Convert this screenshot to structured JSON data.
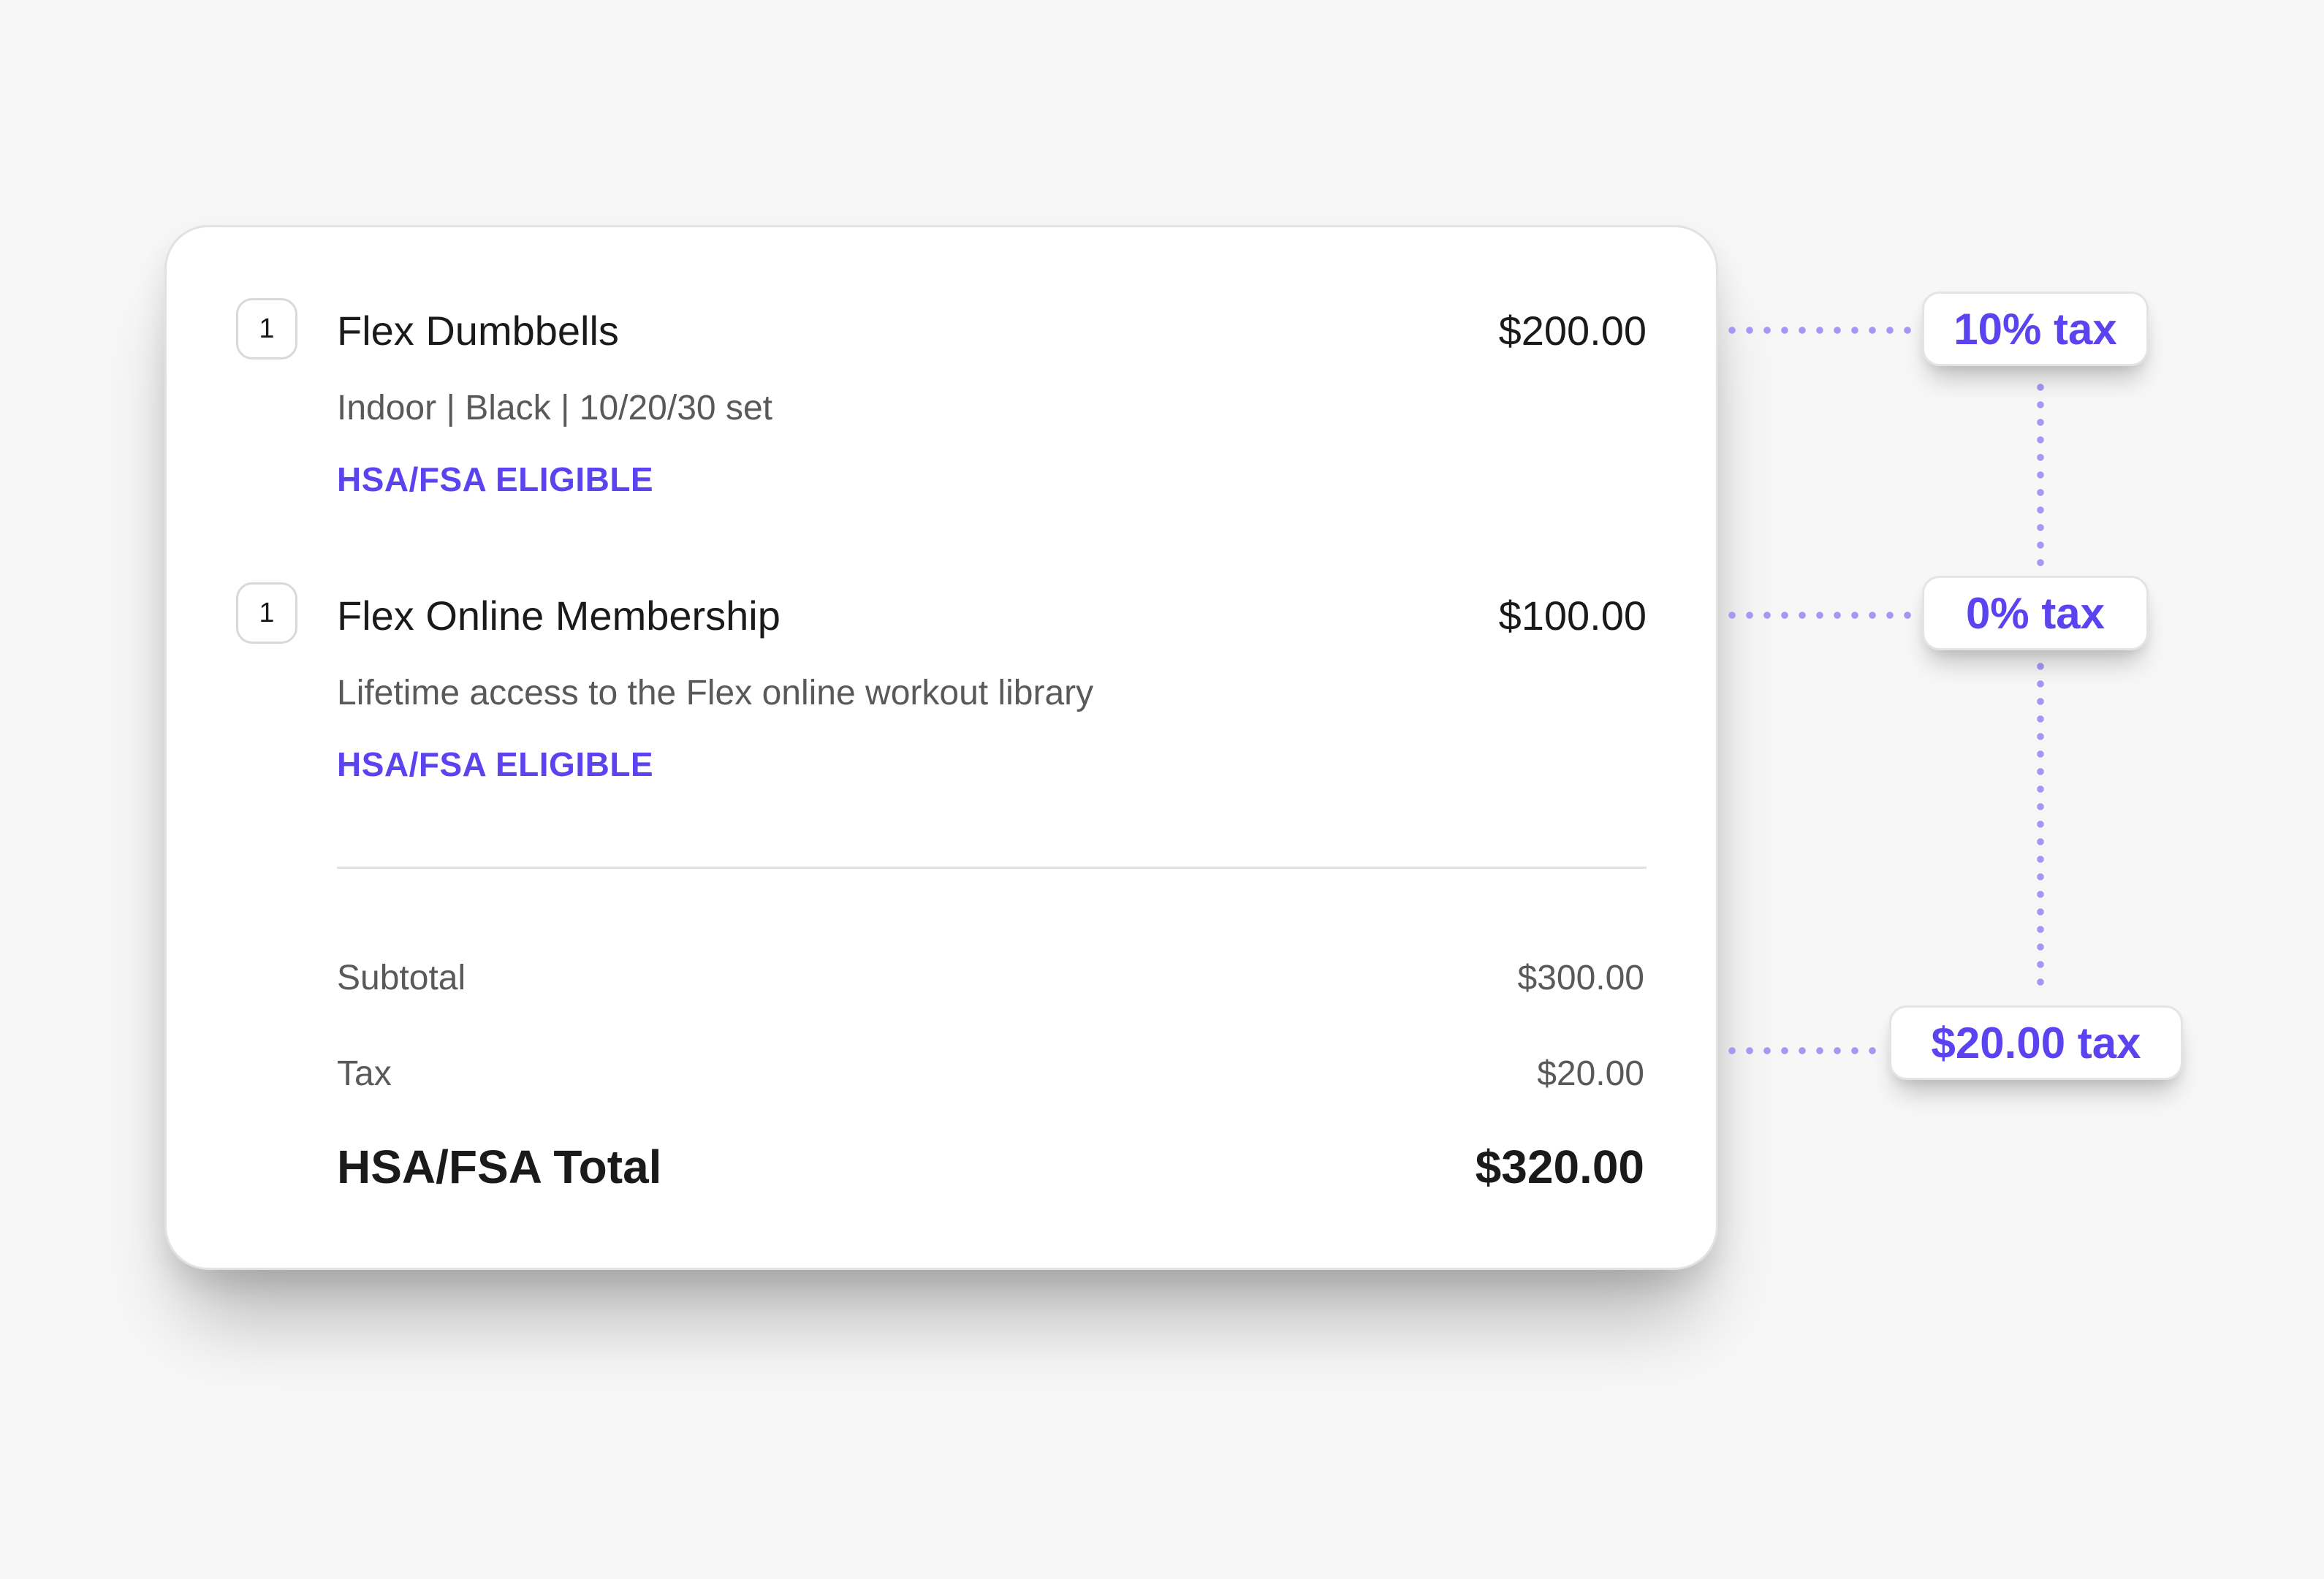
{
  "accent_color": "#5b43f0",
  "items": [
    {
      "quantity": "1",
      "name": "Flex Dumbbells",
      "price": "$200.00",
      "description": "Indoor | Black | 10/20/30 set",
      "badge": "HSA/FSA ELIGIBLE"
    },
    {
      "quantity": "1",
      "name": "Flex Online Membership",
      "price": "$100.00",
      "description": "Lifetime access to the Flex online workout library",
      "badge": "HSA/FSA ELIGIBLE"
    }
  ],
  "summary": {
    "subtotal_label": "Subtotal",
    "subtotal_value": "$300.00",
    "tax_label": "Tax",
    "tax_value": "$20.00",
    "total_label": "HSA/FSA Total",
    "total_value": "$320.00"
  },
  "tax_callouts": {
    "item1": "10% tax",
    "item2": "0% tax",
    "total": "$20.00 tax"
  }
}
